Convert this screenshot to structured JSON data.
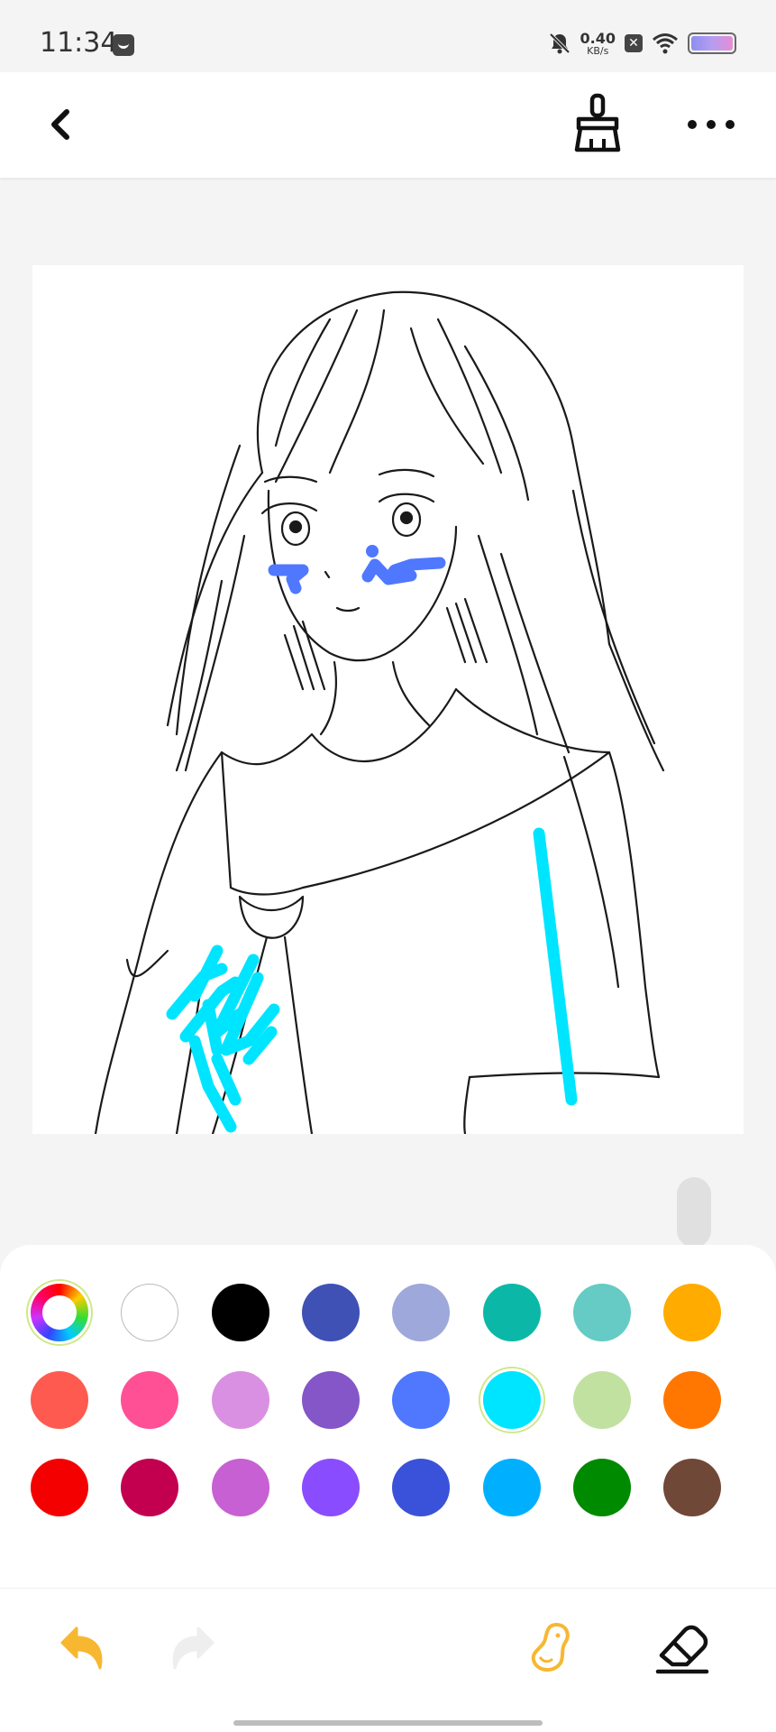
{
  "status_bar": {
    "time": "11:34",
    "net_speed_value": "0.40",
    "net_speed_unit": "KB/s",
    "icons": [
      "message-icon",
      "mute-icon",
      "sim-off-icon",
      "wifi-icon",
      "battery-icon"
    ]
  },
  "app_bar": {
    "icons": [
      "back-arrow-icon",
      "broom-icon",
      "more-icon"
    ]
  },
  "palette": {
    "selected_color": "#00e5ff",
    "rows": [
      [
        "color-wheel",
        "#ffffff",
        "#000000",
        "#3f51b5",
        "#9fa8da",
        "#0bb8a8",
        "#65cbc4",
        "#ffab00"
      ],
      [
        "#ff5a50",
        "#ff5096",
        "#da90e2",
        "#8456c8",
        "#4f78ff",
        "#00e5ff",
        "#c1e1a0",
        "#ff7700"
      ],
      [
        "#f50000",
        "#c2004f",
        "#c760d2",
        "#8a4cff",
        "#3a52d9",
        "#00b0ff",
        "#008a00",
        "#704838"
      ]
    ]
  },
  "toolbar": {
    "icons": [
      "undo-icon",
      "redo-icon",
      "peanut-bucket-icon",
      "eraser-icon"
    ],
    "accent_color": "#f7b731"
  },
  "colors": {
    "canvas_bg": "#ffffff",
    "page_bg": "#f4f4f4",
    "stroke_blue": "#4f78ff",
    "stroke_cyan": "#00e5ff"
  }
}
